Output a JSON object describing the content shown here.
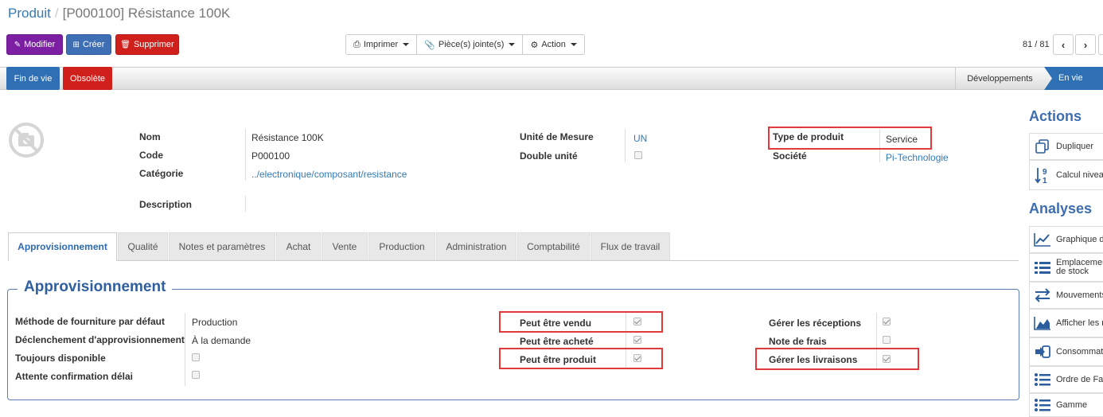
{
  "breadcrumb": {
    "parent": "Produit",
    "separator": "/",
    "current": "[P000100] Résistance 100K"
  },
  "toolbar": {
    "modifier": "Modifier",
    "creer": "Créer",
    "supprimer": "Supprimer",
    "imprimer": "Imprimer",
    "pieces": "Pièce(s) jointe(s)",
    "action": "Action",
    "pager": "81 / 81"
  },
  "statusbar": {
    "fin_de_vie": "Fin de vie",
    "obsolete": "Obsolète",
    "stage_dev": "Développements",
    "stage_current": "En vie",
    "stage_color": "#2f6fb3"
  },
  "form": {
    "nom_label": "Nom",
    "nom": "Résistance 100K",
    "code_label": "Code",
    "code": "P000100",
    "categorie_label": "Catégorie",
    "categorie": "../electronique/composant/resistance",
    "description_label": "Description",
    "unite_label": "Unité de Mesure",
    "unite": "UN",
    "double_unite_label": "Double unité",
    "double_unite": false,
    "type_label": "Type de produit",
    "type": "Service",
    "societe_label": "Société",
    "societe": "Pi-Technologie"
  },
  "tabs": [
    "Approvisionnement",
    "Qualité",
    "Notes et paramètres",
    "Achat",
    "Vente",
    "Production",
    "Administration",
    "Comptabilité",
    "Flux de travail"
  ],
  "section": {
    "title": "Approvisionnement",
    "methode_label": "Méthode de fourniture par défaut",
    "methode": "Production",
    "declenchement_label": "Déclenchement d'approvisionnement",
    "declenchement": "À la demande",
    "toujours_label": "Toujours disponible",
    "toujours": false,
    "attente_label": "Attente confirmation délai",
    "attente": false,
    "vendu_label": "Peut être vendu",
    "vendu": true,
    "achete_label": "Peut être acheté",
    "achete": true,
    "produit_label": "Peut être produit",
    "produit": true,
    "receptions_label": "Gérer les réceptions",
    "receptions": true,
    "frais_label": "Note de frais",
    "frais": false,
    "livraisons_label": "Gérer les livraisons",
    "livraisons": true
  },
  "sidebar": {
    "actions_title": "Actions",
    "actions": [
      {
        "label": "Dupliquer",
        "icon": "copy-icon"
      },
      {
        "label": "Calcul niveau nomenclature",
        "icon": "sort-numeric-icon"
      }
    ],
    "analyses_title": "Analyses",
    "analyses": [
      {
        "label": "Graphique d",
        "icon": "line-chart-icon"
      },
      {
        "label": "Emplacement de stock",
        "icon": "list-icon"
      },
      {
        "label": "Mouvements",
        "icon": "exchange-icon"
      },
      {
        "label": "Afficher les r",
        "icon": "area-chart-icon"
      },
      {
        "label": "Consommat",
        "icon": "sign-in-icon"
      },
      {
        "label": "Ordre de Fa",
        "icon": "list-ul-icon"
      },
      {
        "label": "Gamme",
        "icon": "list-ul-icon"
      }
    ]
  }
}
